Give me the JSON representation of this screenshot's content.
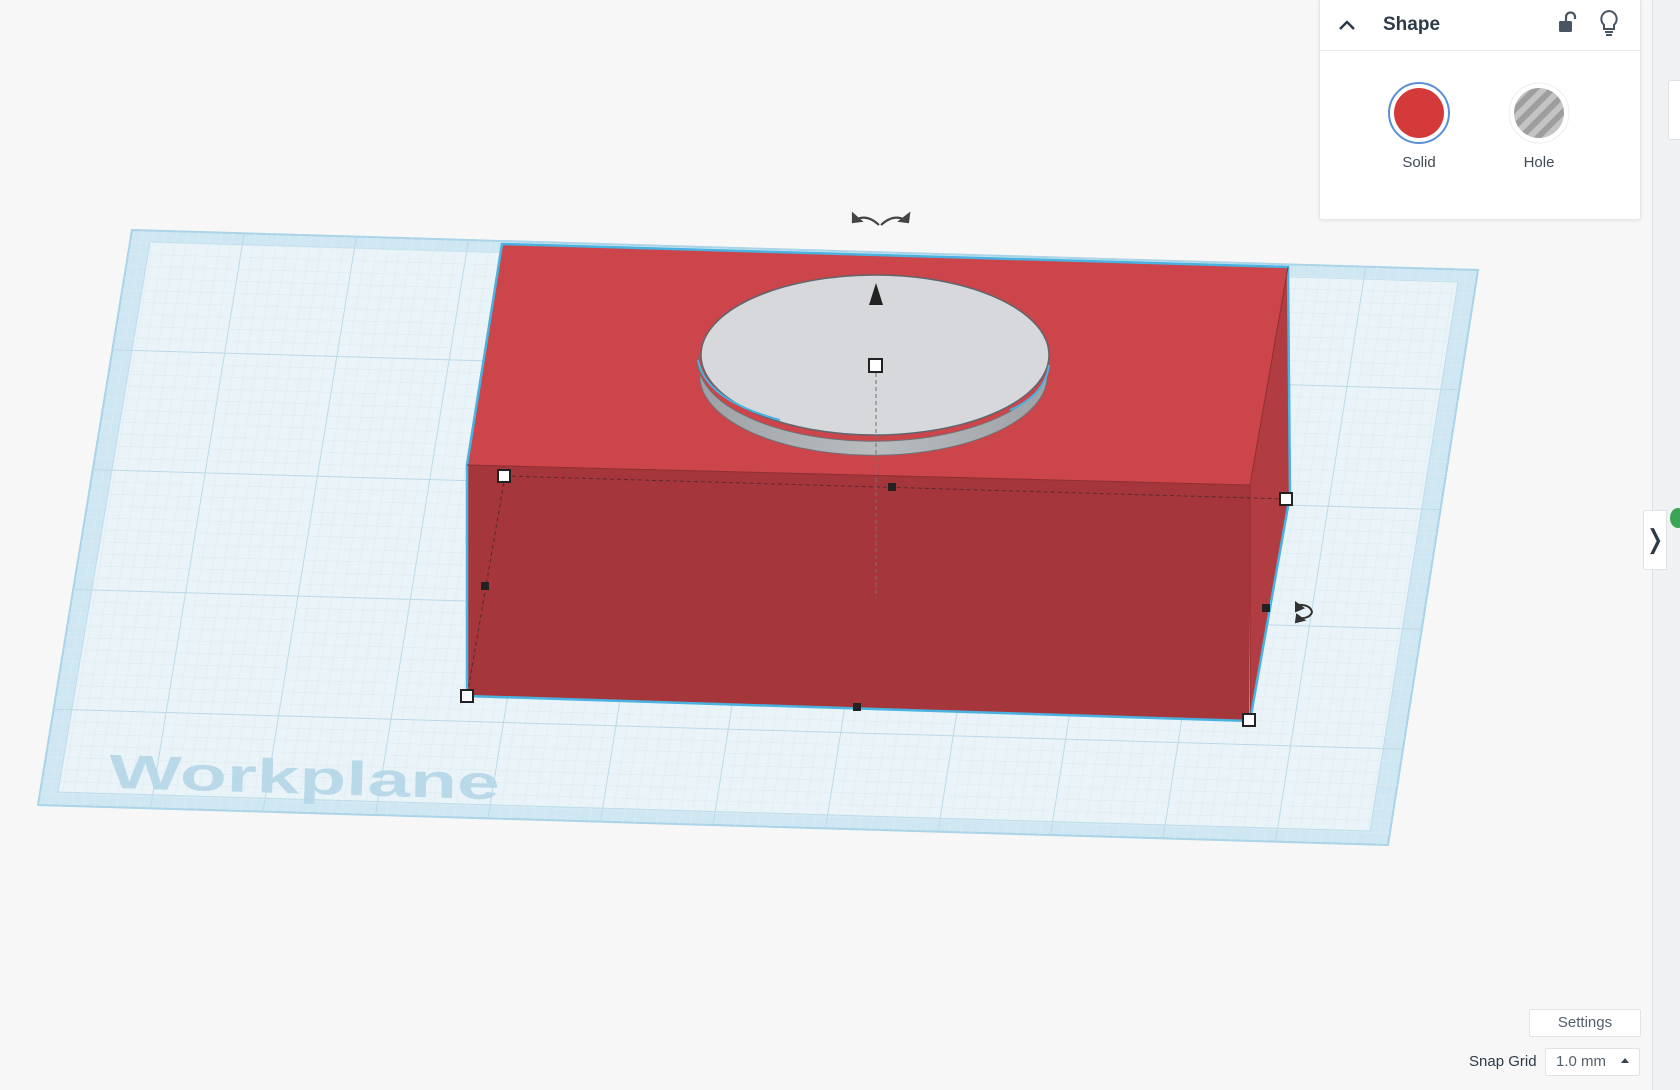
{
  "workplane": {
    "label": "Workplane"
  },
  "shape_panel": {
    "title": "Shape",
    "collapse_icon": "chevron-up-icon",
    "lock_icon": "unlocked-padlock-icon",
    "bulb_icon": "lightbulb-icon",
    "options": [
      {
        "label": "Solid",
        "color": "#d53a3a",
        "selected": true
      },
      {
        "label": "Hole",
        "color": "#b0b0b0",
        "selected": false
      }
    ]
  },
  "object": {
    "box_top_color": "#cc454a",
    "box_front_color": "#a5363b",
    "box_side_color": "#b13d42",
    "cylinder_color": "#d6d8db",
    "selection_color": "#4ab2e0"
  },
  "bottom_bar": {
    "settings_label": "Settings",
    "snap_grid_label": "Snap Grid",
    "snap_grid_value": "1.0 mm"
  },
  "side": {
    "expand_icon": "chevron-right-icon"
  }
}
